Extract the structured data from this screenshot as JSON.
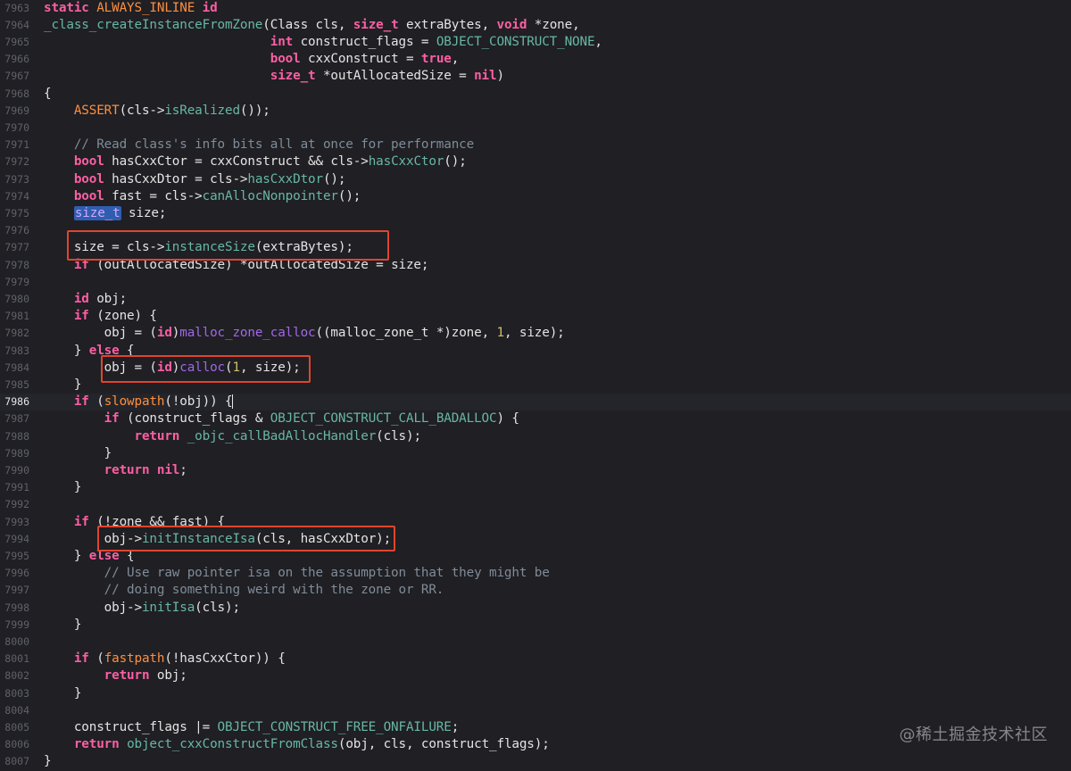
{
  "colors": {
    "background": "#1f1f24",
    "line_number": "#5f6268",
    "keyword": "#fc5fa3",
    "type": "#d0a8ff",
    "function_call": "#a167e6",
    "project_symbol": "#67b7a4",
    "macro": "#fd8f3f",
    "number": "#d0bf69",
    "comment": "#7f8c98",
    "plain_text": "#e4e4e4",
    "highlight_box": "#e0452f",
    "selection": "#2f5eb0"
  },
  "editor": {
    "current_line": "7986",
    "lines": [
      {
        "n": "7963",
        "tokens": [
          [
            "kw",
            "static "
          ],
          [
            "mac",
            "ALWAYS_INLINE "
          ],
          [
            "kw",
            "id"
          ]
        ]
      },
      {
        "n": "7964",
        "tokens": [
          [
            "proj",
            "_class_createInstanceFromZone"
          ],
          [
            "plain",
            "(Class cls, "
          ],
          [
            "kw",
            "size_t"
          ],
          [
            "plain",
            " extraBytes, "
          ],
          [
            "kw",
            "void"
          ],
          [
            "plain",
            " *zone,"
          ]
        ]
      },
      {
        "n": "7965",
        "tokens": [
          [
            "plain",
            "                              "
          ],
          [
            "kw",
            "int"
          ],
          [
            "plain",
            " construct_flags = "
          ],
          [
            "proj",
            "OBJECT_CONSTRUCT_NONE"
          ],
          [
            "plain",
            ","
          ]
        ]
      },
      {
        "n": "7966",
        "tokens": [
          [
            "plain",
            "                              "
          ],
          [
            "kw",
            "bool"
          ],
          [
            "plain",
            " cxxConstruct = "
          ],
          [
            "kw",
            "true"
          ],
          [
            "plain",
            ","
          ]
        ]
      },
      {
        "n": "7967",
        "tokens": [
          [
            "plain",
            "                              "
          ],
          [
            "kw",
            "size_t"
          ],
          [
            "plain",
            " *outAllocatedSize = "
          ],
          [
            "kw",
            "nil"
          ],
          [
            "plain",
            ")"
          ]
        ]
      },
      {
        "n": "7968",
        "tokens": [
          [
            "plain",
            "{"
          ]
        ]
      },
      {
        "n": "7969",
        "tokens": [
          [
            "plain",
            "    "
          ],
          [
            "mac",
            "ASSERT"
          ],
          [
            "plain",
            "(cls->"
          ],
          [
            "proj",
            "isRealized"
          ],
          [
            "plain",
            "());"
          ]
        ]
      },
      {
        "n": "7970",
        "tokens": []
      },
      {
        "n": "7971",
        "tokens": [
          [
            "plain",
            "    "
          ],
          [
            "cmt",
            "// Read class's info bits all at once for performance"
          ]
        ]
      },
      {
        "n": "7972",
        "tokens": [
          [
            "plain",
            "    "
          ],
          [
            "kw",
            "bool"
          ],
          [
            "plain",
            " hasCxxCtor = cxxConstruct && cls->"
          ],
          [
            "proj",
            "hasCxxCtor"
          ],
          [
            "plain",
            "();"
          ]
        ]
      },
      {
        "n": "7973",
        "tokens": [
          [
            "plain",
            "    "
          ],
          [
            "kw",
            "bool"
          ],
          [
            "plain",
            " hasCxxDtor = cls->"
          ],
          [
            "proj",
            "hasCxxDtor"
          ],
          [
            "plain",
            "();"
          ]
        ]
      },
      {
        "n": "7974",
        "tokens": [
          [
            "plain",
            "    "
          ],
          [
            "kw",
            "bool"
          ],
          [
            "plain",
            " fast = cls->"
          ],
          [
            "proj",
            "canAllocNonpointer"
          ],
          [
            "plain",
            "();"
          ]
        ]
      },
      {
        "n": "7975",
        "tokens": [
          [
            "plain",
            "    "
          ],
          [
            "hl",
            "size_t"
          ],
          [
            "plain",
            " size;"
          ]
        ]
      },
      {
        "n": "7976",
        "tokens": []
      },
      {
        "n": "7977",
        "tokens": [
          [
            "plain",
            "    size = cls->"
          ],
          [
            "proj",
            "instanceSize"
          ],
          [
            "plain",
            "(extraBytes);"
          ]
        ]
      },
      {
        "n": "7978",
        "tokens": [
          [
            "plain",
            "    "
          ],
          [
            "kw",
            "if"
          ],
          [
            "plain",
            " (outAllocatedSize) *outAllocatedSize = size;"
          ]
        ]
      },
      {
        "n": "7979",
        "tokens": []
      },
      {
        "n": "7980",
        "tokens": [
          [
            "plain",
            "    "
          ],
          [
            "kw",
            "id"
          ],
          [
            "plain",
            " obj;"
          ]
        ]
      },
      {
        "n": "7981",
        "tokens": [
          [
            "plain",
            "    "
          ],
          [
            "kw",
            "if"
          ],
          [
            "plain",
            " (zone) {"
          ]
        ]
      },
      {
        "n": "7982",
        "tokens": [
          [
            "plain",
            "        obj = ("
          ],
          [
            "kw",
            "id"
          ],
          [
            "plain",
            ")"
          ],
          [
            "func",
            "malloc_zone_calloc"
          ],
          [
            "plain",
            "((malloc_zone_t *)zone, "
          ],
          [
            "num",
            "1"
          ],
          [
            "plain",
            ", size);"
          ]
        ]
      },
      {
        "n": "7983",
        "tokens": [
          [
            "plain",
            "    } "
          ],
          [
            "kw",
            "else"
          ],
          [
            "plain",
            " {"
          ]
        ]
      },
      {
        "n": "7984",
        "tokens": [
          [
            "plain",
            "        obj = ("
          ],
          [
            "kw",
            "id"
          ],
          [
            "plain",
            ")"
          ],
          [
            "func",
            "calloc"
          ],
          [
            "plain",
            "("
          ],
          [
            "num",
            "1"
          ],
          [
            "plain",
            ", size);"
          ]
        ]
      },
      {
        "n": "7985",
        "tokens": [
          [
            "plain",
            "    }"
          ]
        ]
      },
      {
        "n": "7986",
        "tokens": [
          [
            "plain",
            "    "
          ],
          [
            "kw",
            "if"
          ],
          [
            "plain",
            " ("
          ],
          [
            "mac",
            "slowpath"
          ],
          [
            "plain",
            "(!obj)) {"
          ],
          [
            "caret",
            ""
          ]
        ]
      },
      {
        "n": "7987",
        "tokens": [
          [
            "plain",
            "        "
          ],
          [
            "kw",
            "if"
          ],
          [
            "plain",
            " (construct_flags & "
          ],
          [
            "proj",
            "OBJECT_CONSTRUCT_CALL_BADALLOC"
          ],
          [
            "plain",
            ") {"
          ]
        ]
      },
      {
        "n": "7988",
        "tokens": [
          [
            "plain",
            "            "
          ],
          [
            "kw",
            "return"
          ],
          [
            "plain",
            " "
          ],
          [
            "proj",
            "_objc_callBadAllocHandler"
          ],
          [
            "plain",
            "(cls);"
          ]
        ]
      },
      {
        "n": "7989",
        "tokens": [
          [
            "plain",
            "        }"
          ]
        ]
      },
      {
        "n": "7990",
        "tokens": [
          [
            "plain",
            "        "
          ],
          [
            "kw",
            "return"
          ],
          [
            "plain",
            " "
          ],
          [
            "kw",
            "nil"
          ],
          [
            "plain",
            ";"
          ]
        ]
      },
      {
        "n": "7991",
        "tokens": [
          [
            "plain",
            "    }"
          ]
        ]
      },
      {
        "n": "7992",
        "tokens": []
      },
      {
        "n": "7993",
        "tokens": [
          [
            "plain",
            "    "
          ],
          [
            "kw",
            "if"
          ],
          [
            "plain",
            " (!zone && fast) {"
          ]
        ]
      },
      {
        "n": "7994",
        "tokens": [
          [
            "plain",
            "        obj->"
          ],
          [
            "proj",
            "initInstanceIsa"
          ],
          [
            "plain",
            "(cls, hasCxxDtor);"
          ]
        ]
      },
      {
        "n": "7995",
        "tokens": [
          [
            "plain",
            "    } "
          ],
          [
            "kw",
            "else"
          ],
          [
            "plain",
            " {"
          ]
        ]
      },
      {
        "n": "7996",
        "tokens": [
          [
            "plain",
            "        "
          ],
          [
            "cmt",
            "// Use raw pointer isa on the assumption that they might be"
          ]
        ]
      },
      {
        "n": "7997",
        "tokens": [
          [
            "plain",
            "        "
          ],
          [
            "cmt",
            "// doing something weird with the zone or RR."
          ]
        ]
      },
      {
        "n": "7998",
        "tokens": [
          [
            "plain",
            "        obj->"
          ],
          [
            "proj",
            "initIsa"
          ],
          [
            "plain",
            "(cls);"
          ]
        ]
      },
      {
        "n": "7999",
        "tokens": [
          [
            "plain",
            "    }"
          ]
        ]
      },
      {
        "n": "8000",
        "tokens": []
      },
      {
        "n": "8001",
        "tokens": [
          [
            "plain",
            "    "
          ],
          [
            "kw",
            "if"
          ],
          [
            "plain",
            " ("
          ],
          [
            "mac",
            "fastpath"
          ],
          [
            "plain",
            "(!hasCxxCtor)) {"
          ]
        ]
      },
      {
        "n": "8002",
        "tokens": [
          [
            "plain",
            "        "
          ],
          [
            "kw",
            "return"
          ],
          [
            "plain",
            " obj;"
          ]
        ]
      },
      {
        "n": "8003",
        "tokens": [
          [
            "plain",
            "    }"
          ]
        ]
      },
      {
        "n": "8004",
        "tokens": []
      },
      {
        "n": "8005",
        "tokens": [
          [
            "plain",
            "    construct_flags |= "
          ],
          [
            "proj",
            "OBJECT_CONSTRUCT_FREE_ONFAILURE"
          ],
          [
            "plain",
            ";"
          ]
        ]
      },
      {
        "n": "8006",
        "tokens": [
          [
            "plain",
            "    "
          ],
          [
            "kw",
            "return"
          ],
          [
            "plain",
            " "
          ],
          [
            "proj",
            "object_cxxConstructFromClass"
          ],
          [
            "plain",
            "(obj, cls, construct_flags);"
          ]
        ]
      },
      {
        "n": "8007",
        "tokens": [
          [
            "plain",
            "}"
          ]
        ]
      }
    ]
  },
  "watermark": "@稀土掘金技术社区"
}
